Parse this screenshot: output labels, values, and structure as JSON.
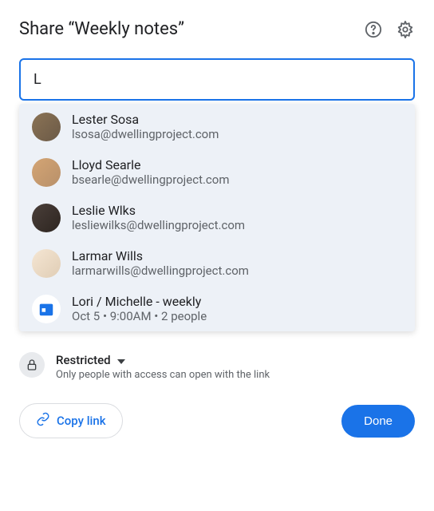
{
  "title": "Share “Weekly notes”",
  "search": {
    "value": "L"
  },
  "suggestions": [
    {
      "name": "Lester Sosa",
      "email": "lsosa@dwellingproject.com"
    },
    {
      "name": "Lloyd Searle",
      "email": "bsearle@dwellingproject.com"
    },
    {
      "name": "Leslie Wlks",
      "email": "lesliewilks@dwellingproject.com"
    },
    {
      "name": "Larmar Wills",
      "email": "larmarwills@dwellingproject.com"
    },
    {
      "name": "Lori / Michelle - weekly",
      "email": "Oct 5 • 9:00AM • 2 people"
    }
  ],
  "access": {
    "label": "Restricted",
    "description": "Only people with access can open with the link"
  },
  "buttons": {
    "copy": "Copy link",
    "done": "Done"
  }
}
